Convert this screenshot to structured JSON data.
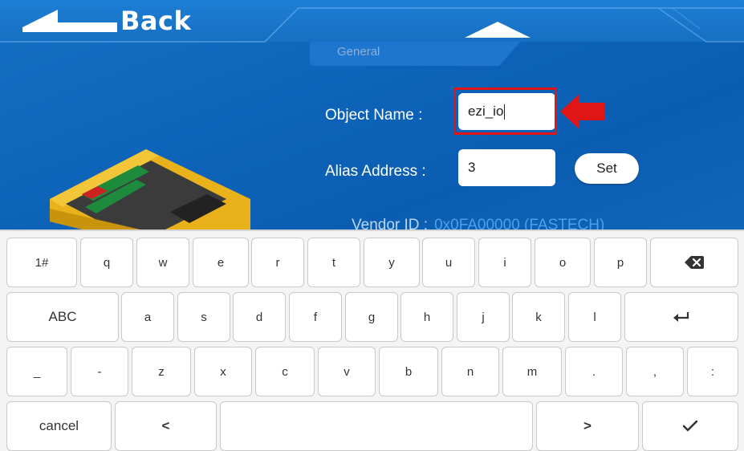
{
  "header": {
    "back_label": "Back",
    "tab_label": "General"
  },
  "form": {
    "object_name_label": "Object Name :",
    "object_name_value": "ezi_io",
    "alias_label": "Alias Address :",
    "alias_value": "3",
    "set_label": "Set",
    "vendor_label": "Vendor ID :",
    "vendor_value": "0x0FA00000 (FASTECH)"
  },
  "keyboard": {
    "row1": [
      "1#",
      "q",
      "w",
      "e",
      "r",
      "t",
      "y",
      "u",
      "i",
      "o",
      "p"
    ],
    "row2": [
      "ABC",
      "a",
      "s",
      "d",
      "f",
      "g",
      "h",
      "j",
      "k",
      "l"
    ],
    "row3": [
      "_",
      "-",
      "z",
      "x",
      "c",
      "v",
      "b",
      "n",
      "m",
      ".",
      ",",
      ":"
    ],
    "row4": [
      "cancel",
      "<",
      ">"
    ]
  },
  "colors": {
    "accent": "#e01515",
    "background": "#0d63b8",
    "vendor_value": "#4ea0e8"
  }
}
